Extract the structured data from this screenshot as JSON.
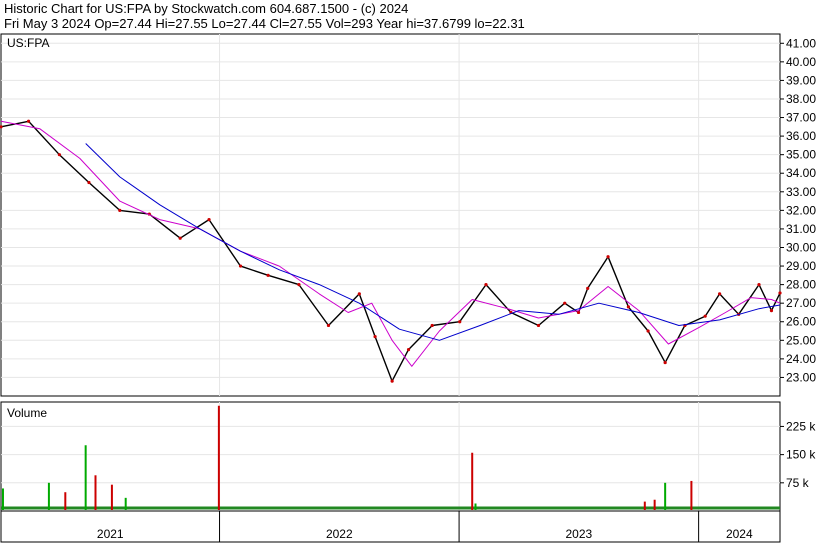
{
  "header": {
    "line1": "Historic Chart for US:FPA by Stockwatch.com 604.687.1500 - (c) 2024",
    "line2": "Fri May  3 2024   Op=27.44   Hi=27.55   Lo=27.44   Cl=27.55   Vol=293   Year hi=37.6799   lo=22.31"
  },
  "chart_data": [
    {
      "type": "line",
      "label": "US:FPA",
      "y_axis_side": "right",
      "ylim": [
        22,
        41.5
      ],
      "y_ticks": [
        "41.00",
        "40.00",
        "39.00",
        "38.00",
        "37.00",
        "36.00",
        "35.00",
        "34.00",
        "33.00",
        "32.00",
        "31.00",
        "30.00",
        "29.00",
        "28.00",
        "27.00",
        "26.00",
        "25.00",
        "24.00",
        "23.00"
      ],
      "y_tick_values": [
        41,
        40,
        39,
        38,
        37,
        36,
        35,
        34,
        33,
        32,
        31,
        30,
        29,
        28,
        27,
        26,
        25,
        24,
        23
      ],
      "x_labels": [
        "2021",
        "2022",
        "2023",
        "2024"
      ],
      "x_label_dates": [
        "2021-01",
        "2022-01",
        "2023-01",
        "2024-01"
      ],
      "year_boundaries": [
        "2021-12-31",
        "2022-12-31",
        "2023-12-31"
      ],
      "x_range": [
        "2021-02-01",
        "2024-05-03"
      ],
      "grid": true,
      "series": [
        {
          "role": "price",
          "color": "#000000",
          "x": [
            "2021-02-01",
            "2021-03-15",
            "2021-05-01",
            "2021-06-15",
            "2021-08-01",
            "2021-09-15",
            "2021-11-01",
            "2021-12-15",
            "2022-02-01",
            "2022-03-15",
            "2022-05-01",
            "2022-06-15",
            "2022-08-01",
            "2022-08-25",
            "2022-09-20",
            "2022-10-15",
            "2022-11-20",
            "2023-01-01",
            "2023-02-10",
            "2023-03-20",
            "2023-05-01",
            "2023-06-10",
            "2023-07-01",
            "2023-07-15",
            "2023-08-15",
            "2023-09-15",
            "2023-10-15",
            "2023-11-10",
            "2023-12-10",
            "2024-01-10",
            "2024-02-01",
            "2024-03-01",
            "2024-04-01",
            "2024-04-20",
            "2024-05-03"
          ],
          "values": [
            36.5,
            36.8,
            35.0,
            33.5,
            32.0,
            31.8,
            30.5,
            31.5,
            29.0,
            28.5,
            28.0,
            25.8,
            27.5,
            25.2,
            22.8,
            24.5,
            25.8,
            26.0,
            28.0,
            26.5,
            25.8,
            27.0,
            26.5,
            27.8,
            29.5,
            26.8,
            25.5,
            23.8,
            25.8,
            26.3,
            27.5,
            26.4,
            28.0,
            26.6,
            27.55
          ]
        },
        {
          "role": "moving-average-short",
          "color": "#cc00cc",
          "x": [
            "2021-02-01",
            "2021-04-01",
            "2021-06-01",
            "2021-08-01",
            "2021-10-01",
            "2021-12-01",
            "2022-02-01",
            "2022-04-01",
            "2022-06-01",
            "2022-07-15",
            "2022-08-20",
            "2022-09-20",
            "2022-10-20",
            "2022-12-01",
            "2023-01-20",
            "2023-03-15",
            "2023-05-01",
            "2023-07-01",
            "2023-08-15",
            "2023-10-01",
            "2023-11-15",
            "2024-01-01",
            "2024-02-10",
            "2024-03-20",
            "2024-04-20",
            "2024-05-03"
          ],
          "values": [
            36.8,
            36.4,
            34.8,
            32.5,
            31.5,
            31.0,
            29.8,
            29.0,
            27.5,
            26.5,
            27.0,
            25.0,
            23.6,
            25.5,
            27.2,
            26.7,
            26.2,
            26.6,
            27.9,
            26.6,
            24.8,
            25.7,
            26.5,
            27.3,
            27.2,
            27.0
          ]
        },
        {
          "role": "moving-average-long",
          "color": "#0000cc",
          "x": [
            "2021-06-10",
            "2021-08-01",
            "2021-10-01",
            "2021-12-01",
            "2022-02-01",
            "2022-04-01",
            "2022-06-01",
            "2022-08-01",
            "2022-10-01",
            "2022-12-01",
            "2023-02-01",
            "2023-04-01",
            "2023-06-01",
            "2023-08-01",
            "2023-10-01",
            "2023-12-01",
            "2024-02-01",
            "2024-04-01",
            "2024-05-03"
          ],
          "values": [
            35.6,
            33.8,
            32.3,
            31.0,
            29.8,
            28.8,
            28.0,
            27.0,
            25.6,
            25.0,
            25.8,
            26.6,
            26.4,
            27.0,
            26.5,
            25.8,
            26.1,
            26.7,
            26.9
          ]
        }
      ]
    },
    {
      "type": "bar",
      "label": "Volume",
      "y_axis_side": "right",
      "ylim": [
        0,
        290
      ],
      "y_ticks": [
        "225 k",
        "150 k",
        "75 k"
      ],
      "y_tick_values": [
        225,
        150,
        75
      ],
      "x_range": [
        "2021-02-01",
        "2024-05-03"
      ],
      "spikes": [
        {
          "x": "2021-02-04",
          "value": 60,
          "color": "#00aa00"
        },
        {
          "x": "2021-04-15",
          "value": 75,
          "color": "#00aa00"
        },
        {
          "x": "2021-05-10",
          "value": 50,
          "color": "#cc0000"
        },
        {
          "x": "2021-06-10",
          "value": 175,
          "color": "#00aa00"
        },
        {
          "x": "2021-06-25",
          "value": 95,
          "color": "#cc0000"
        },
        {
          "x": "2021-07-20",
          "value": 70,
          "color": "#cc0000"
        },
        {
          "x": "2021-08-10",
          "value": 35,
          "color": "#00aa00"
        },
        {
          "x": "2021-12-30",
          "value": 280,
          "color": "#cc0000"
        },
        {
          "x": "2023-01-20",
          "value": 155,
          "color": "#cc0000"
        },
        {
          "x": "2023-01-25",
          "value": 20,
          "color": "#00aa00"
        },
        {
          "x": "2023-10-10",
          "value": 25,
          "color": "#cc0000"
        },
        {
          "x": "2023-10-25",
          "value": 30,
          "color": "#cc0000"
        },
        {
          "x": "2023-11-10",
          "value": 75,
          "color": "#00aa00"
        },
        {
          "x": "2023-12-20",
          "value": 80,
          "color": "#cc0000"
        }
      ],
      "baseline_color": "#228822"
    }
  ]
}
